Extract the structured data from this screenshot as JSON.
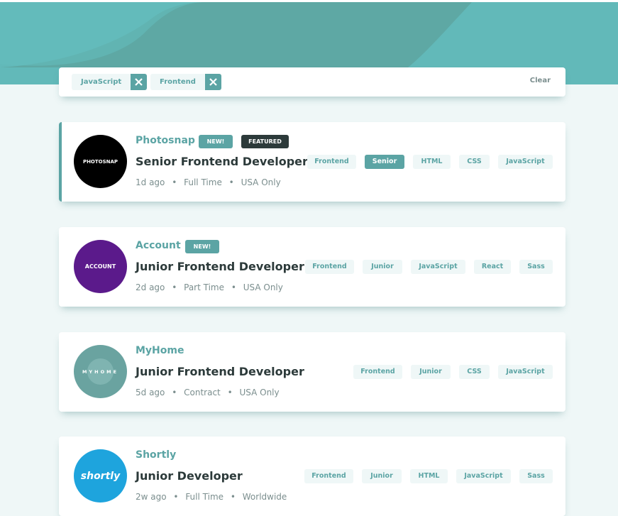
{
  "colors": {
    "primary": "#5ba4a4",
    "header_bg": "#62b9b9",
    "page_bg": "#eff7f7",
    "dark": "#2c3a3a",
    "muted": "#7b8e8e"
  },
  "filters": {
    "chips": [
      {
        "label": "JavaScript",
        "remove_icon": "close-icon"
      },
      {
        "label": "Frontend",
        "remove_icon": "close-icon"
      }
    ],
    "clear_label": "Clear"
  },
  "jobs": [
    {
      "company": "Photosnap",
      "logo_text": "PHOTOSNAP",
      "logo_color": "#000000",
      "new_label": "NEW!",
      "featured_label": "FEATURED",
      "position": "Senior Frontend Developer",
      "posted": "1d ago",
      "contract": "Full Time",
      "location": "USA Only",
      "tags": [
        "Frontend",
        "Senior",
        "HTML",
        "CSS",
        "JavaScript"
      ]
    },
    {
      "company": "Account",
      "logo_text": "ACCOUNT",
      "logo_color": "#5b1a8b",
      "new_label": "NEW!",
      "position": "Junior Frontend Developer",
      "posted": "2d ago",
      "contract": "Part Time",
      "location": "USA Only",
      "tags": [
        "Frontend",
        "Junior",
        "JavaScript",
        "React",
        "Sass"
      ]
    },
    {
      "company": "MyHome",
      "logo_text": "MYHOME",
      "logo_color": "#6aa3a0",
      "position": "Junior Frontend Developer",
      "posted": "5d ago",
      "contract": "Contract",
      "location": "USA Only",
      "tags": [
        "Frontend",
        "Junior",
        "CSS",
        "JavaScript"
      ]
    },
    {
      "company": "Shortly",
      "logo_text": "shortly",
      "logo_color": "#1ea4dd",
      "position": "Junior Developer",
      "posted": "2w ago",
      "contract": "Full Time",
      "location": "Worldwide",
      "tags": [
        "Frontend",
        "Junior",
        "HTML",
        "JavaScript",
        "Sass"
      ]
    }
  ],
  "separator": "•"
}
